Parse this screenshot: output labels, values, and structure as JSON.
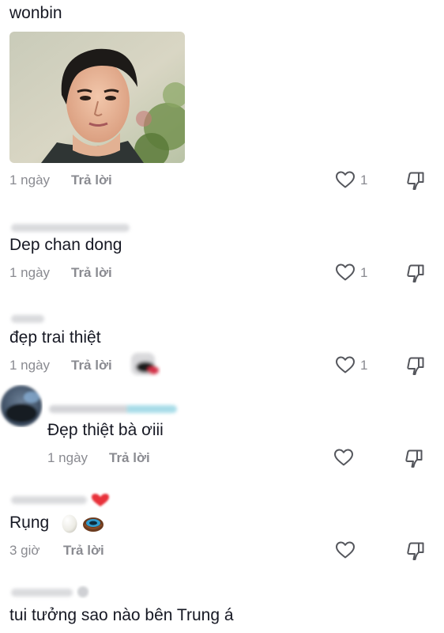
{
  "comments": [
    {
      "text": "wonbin",
      "time": "1 ngày",
      "reply": "Trả lời",
      "likes": "1",
      "has_photo": true
    },
    {
      "text": "Dep chan dong",
      "time": "1 ngày",
      "reply": "Trả lời",
      "likes": "1"
    },
    {
      "text": "đẹp trai thiệt",
      "time": "1 ngày",
      "reply": "Trả lời",
      "likes": "1"
    },
    {
      "text": "Đẹp thiệt bà ơiii",
      "time": "1 ngày",
      "reply": "Trả lời",
      "likes": ""
    },
    {
      "text": "Rụng",
      "time": "3 giờ",
      "reply": "Trả lời",
      "likes": ""
    },
    {
      "text": "tui tưởng sao nào bên Trung á"
    }
  ],
  "icons": {
    "like": "heart-outline-icon",
    "dislike": "thumbs-down-outline-icon"
  },
  "colors": {
    "text": "#161823",
    "meta": "#8a8b91",
    "icon": "#54565c"
  }
}
